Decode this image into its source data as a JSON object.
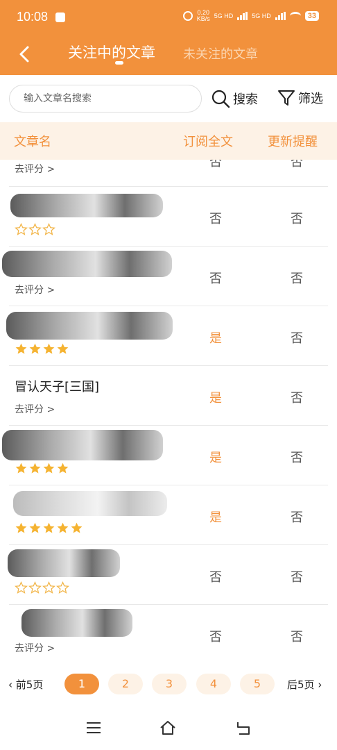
{
  "status_bar": {
    "time": "10:08",
    "net_speed_value": "0.20",
    "net_speed_unit": "KB/s",
    "signal1": "5G HD",
    "signal2": "5G HD",
    "battery": "33"
  },
  "header": {
    "active_tab": "关注中的文章",
    "inactive_tab": "未关注的文章",
    "colors": {
      "accent": "#f2913c",
      "accent_light": "#fdf2e6"
    }
  },
  "search": {
    "placeholder": "输入文章名搜索",
    "search_label": "搜索",
    "filter_label": "筛选"
  },
  "table": {
    "columns": [
      "文章名",
      "订阅全文",
      "更新提醒"
    ],
    "rows": [
      {
        "title": "",
        "sub": "去评分 >",
        "subscribe": "否",
        "remind": "否",
        "stars": null
      },
      {
        "title": "",
        "sub": "",
        "subscribe": "否",
        "remind": "否",
        "stars": 0,
        "star_total": 3
      },
      {
        "title": "",
        "sub": "去评分 >",
        "subscribe": "否",
        "remind": "否",
        "stars": null
      },
      {
        "title": "",
        "sub": "",
        "subscribe": "是",
        "remind": "否",
        "stars": 4,
        "star_total": 4
      },
      {
        "title": "冒认天子[三国]",
        "sub": "去评分 >",
        "subscribe": "是",
        "remind": "否",
        "stars": null
      },
      {
        "title": "",
        "sub": "",
        "subscribe": "是",
        "remind": "否",
        "stars": 4,
        "star_total": 4
      },
      {
        "title": "",
        "sub": "",
        "subscribe": "是",
        "remind": "否",
        "stars": 5,
        "star_total": 5
      },
      {
        "title": "",
        "sub": "",
        "subscribe": "否",
        "remind": "否",
        "stars": 0,
        "star_total": 4
      },
      {
        "title": "",
        "sub": "去评分 >",
        "subscribe": "否",
        "remind": "否",
        "stars": null
      }
    ]
  },
  "pager": {
    "prev": "前5页",
    "next": "后5页",
    "pages": [
      "1",
      "2",
      "3",
      "4",
      "5"
    ],
    "current": "1"
  }
}
